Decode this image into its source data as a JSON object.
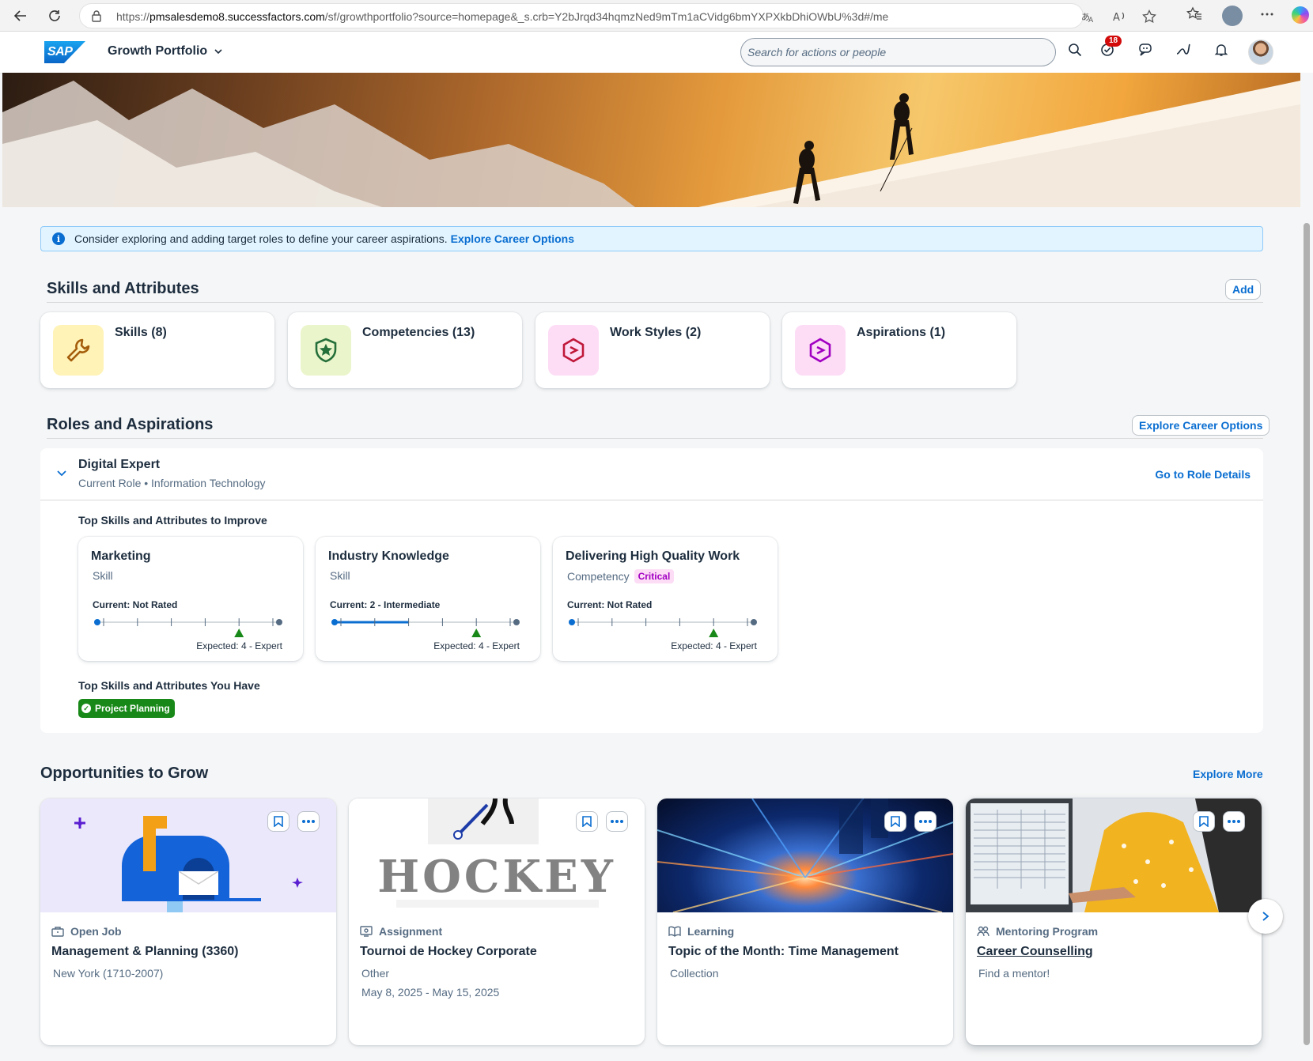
{
  "browser": {
    "url_prefix": "https://",
    "url_host": "pmsalesdemo8.successfactors.com",
    "url_path": "/sf/growthportfolio?source=homepage&_s.crb=Y2bJrqd34hqmzNed9mTm1aCVidg6bmYXPXkbDhiOWbU%3d#/me"
  },
  "shell": {
    "logo_text": "SAP",
    "app_title": "Growth Portfolio",
    "search_placeholder": "Search for actions or people",
    "notification_count": "18"
  },
  "info_strip": {
    "message": "Consider exploring and adding target roles to define your career aspirations.",
    "link": "Explore Career Options"
  },
  "skills_section": {
    "title": "Skills and Attributes",
    "add_label": "Add",
    "tiles": [
      {
        "label": "Skills (8)",
        "icon": "wrench-icon",
        "bg": "#fff3b8",
        "color": "#a45d0a"
      },
      {
        "label": "Competencies (13)",
        "icon": "shield-star-icon",
        "bg": "#ebf5cb",
        "color": "#256f3a"
      },
      {
        "label": "Work Styles (2)",
        "icon": "hexagon-icon",
        "bg": "#fddcf6",
        "color": "#c0183a"
      },
      {
        "label": "Aspirations (1)",
        "icon": "hexagon-icon",
        "bg": "#fddcf6",
        "color": "#a100c2"
      }
    ]
  },
  "roles_section": {
    "title": "Roles and Aspirations",
    "explore_label": "Explore Career Options",
    "role": {
      "name": "Digital Expert",
      "subtitle": "Current Role • Information Technology",
      "details_link": "Go to Role Details"
    },
    "improve_heading": "Top Skills and Attributes to Improve",
    "improve_cards": [
      {
        "title": "Marketing",
        "type": "Skill",
        "critical": "",
        "current": "Current: Not Rated",
        "expected": "Expected: 4 - Expert",
        "current_level": 0,
        "expected_level": 4
      },
      {
        "title": "Industry Knowledge",
        "type": "Skill",
        "critical": "",
        "current": "Current: 2 - Intermediate",
        "expected": "Expected: 4 - Expert",
        "current_level": 2,
        "expected_level": 4
      },
      {
        "title": "Delivering High Quality Work",
        "type": "Competency",
        "critical": "Critical",
        "current": "Current: Not Rated",
        "expected": "Expected: 4 - Expert",
        "current_level": 0,
        "expected_level": 4
      }
    ],
    "have_heading": "Top Skills and Attributes You Have",
    "have_tags": [
      "Project Planning"
    ]
  },
  "opportunities": {
    "title": "Opportunities to Grow",
    "explore_more": "Explore More",
    "cards": [
      {
        "kind": "Open Job",
        "kind_icon": "briefcase-icon",
        "title": "Management & Planning (3360)",
        "line1": "New York (1710-2007)",
        "line2": ""
      },
      {
        "kind": "Assignment",
        "kind_icon": "assignment-icon",
        "title": "Tournoi de Hockey Corporate",
        "line1": "Other",
        "line2": "May 8, 2025 - May 15, 2025",
        "image_text": "HOCKEY"
      },
      {
        "kind": "Learning",
        "kind_icon": "learning-icon",
        "title": "Topic of the Month: Time Management",
        "line1": "Collection",
        "line2": ""
      },
      {
        "kind": "Mentoring Program",
        "kind_icon": "mentoring-icon",
        "title": "Career Counselling",
        "line1": "Find a mentor!",
        "line2": ""
      }
    ]
  },
  "colors": {
    "brand_blue": "#0a6ed1",
    "success_green": "#188918",
    "critical_pink": "#a100c2"
  }
}
